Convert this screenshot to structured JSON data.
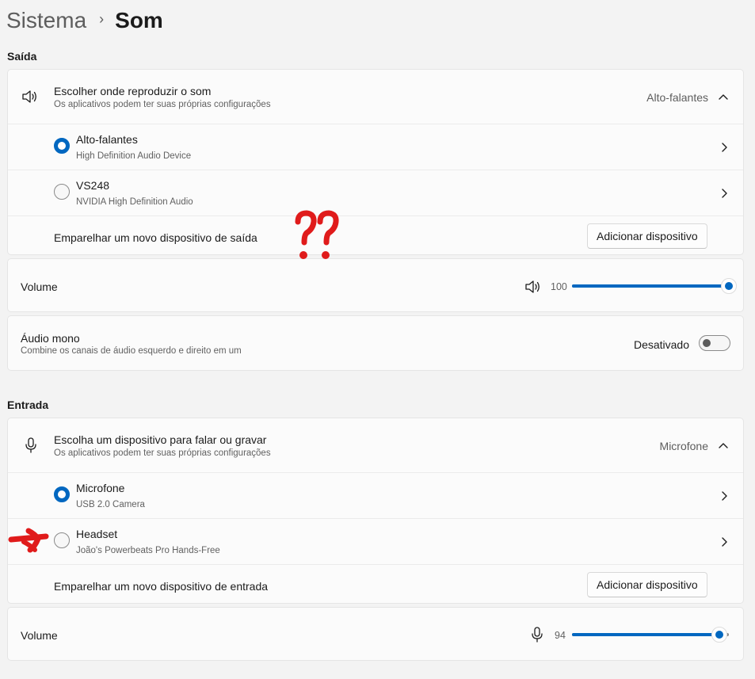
{
  "breadcrumb": {
    "parent": "Sistema",
    "separator": "›",
    "current": "Som"
  },
  "output": {
    "section_title": "Saída",
    "chooser": {
      "title": "Escolher onde reproduzir o som",
      "subtitle": "Os aplicativos podem ter suas próprias configurações",
      "selected": "Alto-falantes",
      "icon": "speaker-icon"
    },
    "devices": [
      {
        "name": "Alto-falantes",
        "detail": "High Definition Audio Device",
        "selected": true
      },
      {
        "name": "VS248",
        "detail": "NVIDIA High Definition Audio",
        "selected": false
      }
    ],
    "pair": {
      "label": "Emparelhar um novo dispositivo de saída",
      "button": "Adicionar dispositivo"
    },
    "volume": {
      "label": "Volume",
      "value": "100",
      "level_percent": 100
    },
    "mono": {
      "title": "Áudio mono",
      "subtitle": "Combine os canais de áudio esquerdo e direito em um",
      "state": "Desativado",
      "on": false
    }
  },
  "input": {
    "section_title": "Entrada",
    "chooser": {
      "title": "Escolha um dispositivo para falar ou gravar",
      "subtitle": "Os aplicativos podem ter suas próprias configurações",
      "selected": "Microfone",
      "icon": "microphone-icon"
    },
    "devices": [
      {
        "name": "Microfone",
        "detail": "USB 2.0 Camera",
        "selected": true
      },
      {
        "name": "Headset",
        "detail": "João's Powerbeats Pro Hands-Free",
        "selected": false
      }
    ],
    "pair": {
      "label": "Emparelhar um novo dispositivo de entrada",
      "button": "Adicionar dispositivo"
    },
    "volume": {
      "label": "Volume",
      "value": "94",
      "level_percent": 94
    }
  },
  "colors": {
    "accent": "#0067c0",
    "annotation": "#e01b1b",
    "background": "#f3f3f3",
    "card": "#fbfbfb"
  }
}
